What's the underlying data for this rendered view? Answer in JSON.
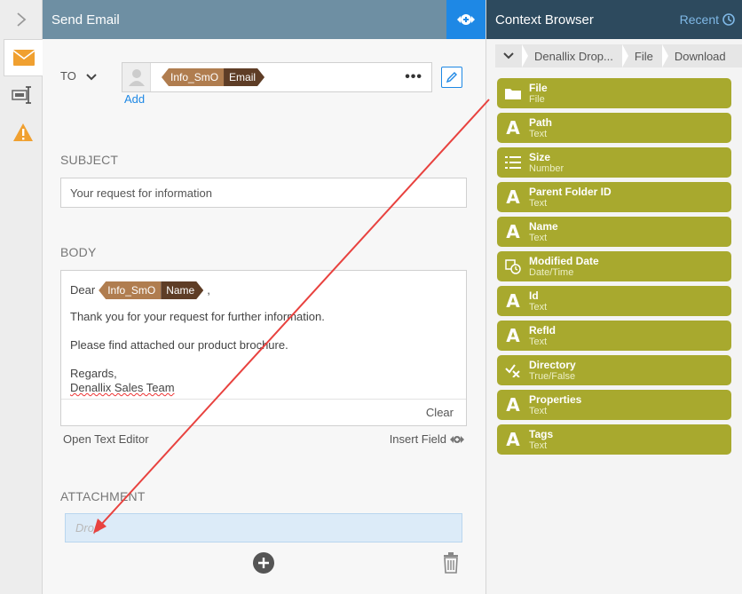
{
  "main": {
    "title": "Send Email",
    "to_label": "TO",
    "to_tag": {
      "source": "Info_SmO",
      "field": "Email"
    },
    "add_label": "Add",
    "subject_label": "SUBJECT",
    "subject_value": "Your request for information",
    "body_label": "BODY",
    "body": {
      "greeting": "Dear",
      "tag": {
        "source": "Info_SmO",
        "field": "Name"
      },
      "greeting_suffix": ",",
      "line1": "Thank you for your request for further information.",
      "line2": "Please find attached our product brochure.",
      "line3": "Regards,",
      "line4": "Denallix Sales Team",
      "clear_label": "Clear"
    },
    "open_editor_label": "Open Text Editor",
    "insert_field_label": "Insert Field",
    "attachment_label": "ATTACHMENT",
    "drop_placeholder": "Drop"
  },
  "context": {
    "title": "Context Browser",
    "recent_label": "Recent",
    "breadcrumbs": [
      "Denallix Drop...",
      "File",
      "Download"
    ],
    "fields": [
      {
        "name": "File",
        "type": "File",
        "icon": "folder-icon"
      },
      {
        "name": "Path",
        "type": "Text",
        "icon": "text-icon"
      },
      {
        "name": "Size",
        "type": "Number",
        "icon": "number-icon"
      },
      {
        "name": "Parent Folder ID",
        "type": "Text",
        "icon": "text-icon"
      },
      {
        "name": "Name",
        "type": "Text",
        "icon": "text-icon"
      },
      {
        "name": "Modified Date",
        "type": "Date/Time",
        "icon": "datetime-icon"
      },
      {
        "name": "Id",
        "type": "Text",
        "icon": "text-icon"
      },
      {
        "name": "RefId",
        "type": "Text",
        "icon": "text-icon"
      },
      {
        "name": "Directory",
        "type": "True/False",
        "icon": "boolean-icon"
      },
      {
        "name": "Properties",
        "type": "Text",
        "icon": "text-icon"
      },
      {
        "name": "Tags",
        "type": "Text",
        "icon": "text-icon"
      }
    ]
  },
  "colors": {
    "field_bg": "#a8a92e",
    "header_main": "#6e8fa3",
    "header_ctx": "#2d4a5e",
    "accent": "#1e88e5",
    "tag_source": "#b07d4f",
    "tag_field": "#5e3d26",
    "drag_arrow": "#e8423f"
  }
}
